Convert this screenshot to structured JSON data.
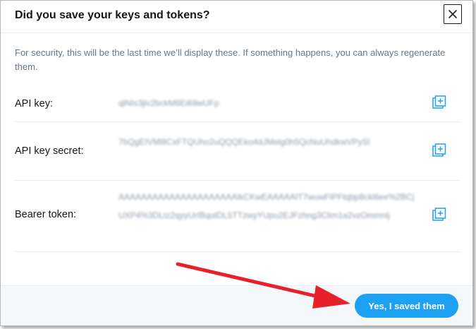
{
  "dialog": {
    "title": "Did you save your keys and tokens?",
    "description": "For security, this will be the last time we’ll display these. If something happens, you can always regenerate them.",
    "rows": [
      {
        "label": "API key:",
        "value": "qlNIs3jlv2bckM6Ei69wUFp"
      },
      {
        "label": "API key secret:",
        "value": "7bQgEIVMl8CxFTQUho2uQQQEko4dJMelg0h5QcNuUhdkwVPySl"
      },
      {
        "label": "Bearer token:",
        "value": "AAAAAAAAAAAAAAAAAAAAAIkCKwEAAAAAIT7wuwFIPFtqbp8ckl6ee%2BCjUXP4%3DLtz2qyyUrIBqutDL5TTzwyYUpu2EJFzhng3Clim1a2vzOmmnlj"
      }
    ],
    "icons": {
      "close": "close-icon",
      "copy": "copy-icon"
    },
    "confirm_label": "Yes, I saved them"
  },
  "colors": {
    "accent": "#1da1f2",
    "annotation_arrow": "#e8202a"
  }
}
